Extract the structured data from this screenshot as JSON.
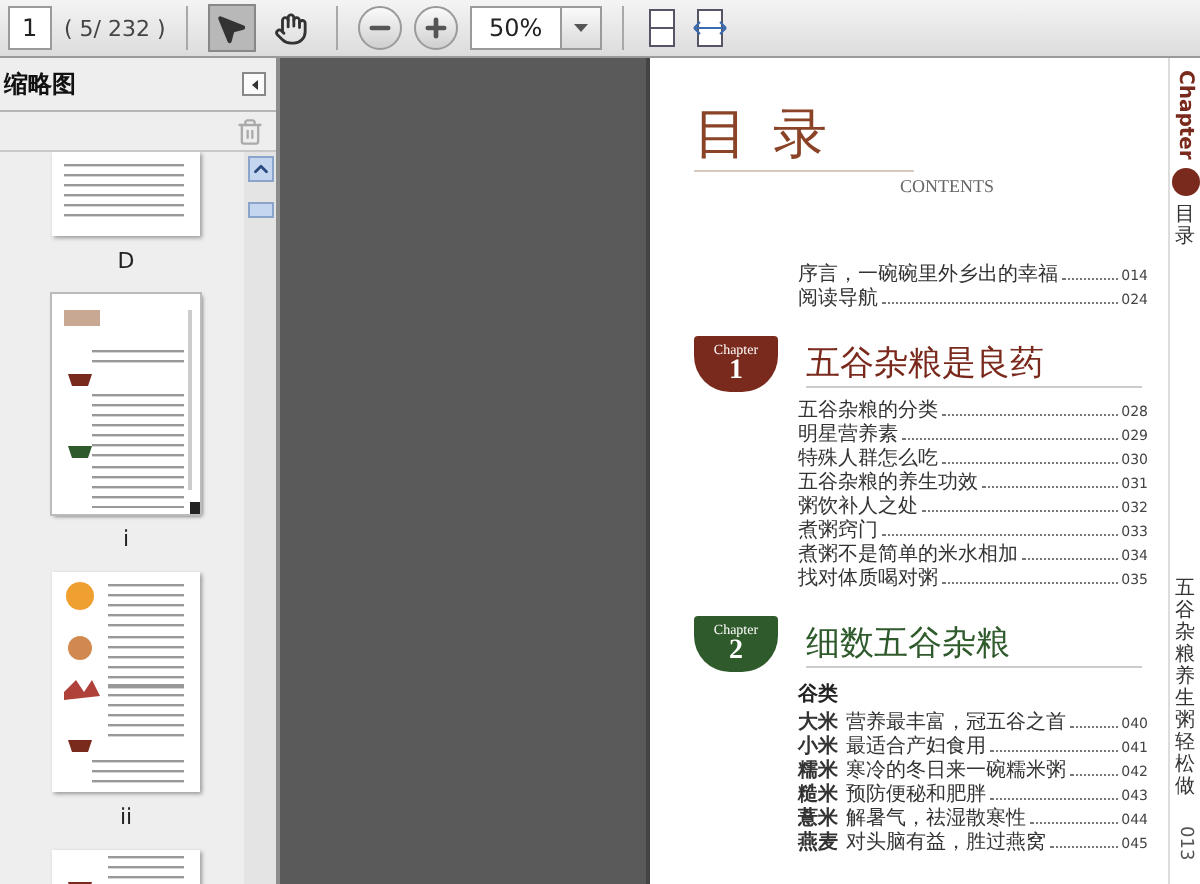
{
  "toolbar": {
    "page_field": "1",
    "page_count": "( 5/ 232 )",
    "zoom_field": "50%",
    "tools": [
      {
        "kind": "select",
        "selected": true
      },
      {
        "kind": "hand",
        "selected": false
      }
    ]
  },
  "thumbnails_panel": {
    "title": "缩略图",
    "thumbnails": [
      {
        "kind": "text",
        "label": "D",
        "selected": false
      },
      {
        "kind": "contents",
        "label": "i",
        "selected": true
      },
      {
        "kind": "pictures",
        "label": "ii",
        "selected": false
      },
      {
        "kind": "pictures",
        "selected": false
      }
    ]
  },
  "page": {
    "heading": "目 录",
    "subtitle": "CONTENTS",
    "intro": [
      {
        "title": "序言，一碗碗里外乡出的幸福",
        "page": "014"
      },
      {
        "title": "阅读导航",
        "page": "024"
      }
    ],
    "chapters": [
      {
        "badge": "Chapter",
        "number": "1",
        "title": "五谷杂粮是良药",
        "color": "#7a2a1c",
        "entries": [
          {
            "title": "五谷杂粮的分类",
            "page": "028"
          },
          {
            "title": "明星营养素",
            "page": "029"
          },
          {
            "title": "特殊人群怎么吃",
            "page": "030"
          },
          {
            "title": "五谷杂粮的养生功效",
            "page": "031"
          },
          {
            "title": "粥饮补人之处",
            "page": "032"
          },
          {
            "title": "煮粥窍门",
            "page": "033"
          },
          {
            "title": "煮粥不是简单的米水相加",
            "page": "034"
          },
          {
            "title": "找对体质喝对粥",
            "page": "035"
          }
        ]
      },
      {
        "badge": "Chapter",
        "number": "2",
        "title": "细数五谷杂粮",
        "color": "#2f5a2c",
        "section": "谷类",
        "entries": [
          {
            "name": "大米",
            "title": "营养最丰富，冠五谷之首",
            "page": "040"
          },
          {
            "name": "小米",
            "title": "最适合产妇食用",
            "page": "041"
          },
          {
            "name": "糯米",
            "title": "寒冷的冬日来一碗糯米粥",
            "page": "042"
          },
          {
            "name": "糙米",
            "title": "预防便秘和肥胖",
            "page": "043"
          },
          {
            "name": "薏米",
            "title": "解暑气，祛湿散寒性",
            "page": "044"
          },
          {
            "name": "燕麦",
            "title": "对头脑有益，胜过燕窝",
            "page": "045"
          }
        ]
      }
    ],
    "side_tab": {
      "chapter": "Chapter",
      "label": "目录",
      "book_title": "五谷杂粮养生粥轻松做",
      "page_number": "013"
    }
  }
}
